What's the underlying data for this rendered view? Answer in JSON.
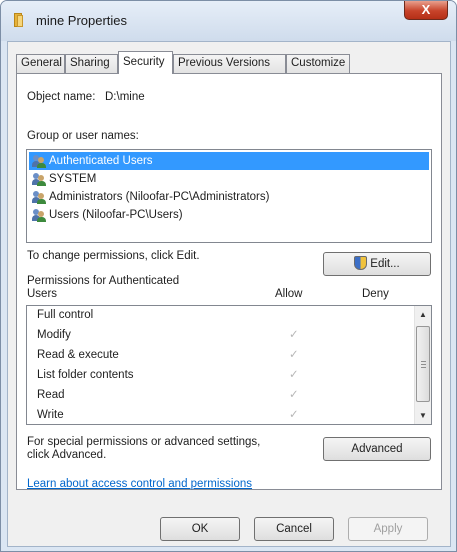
{
  "window": {
    "title": "mine Properties",
    "close_label": "X"
  },
  "tabs": [
    {
      "label": "General"
    },
    {
      "label": "Sharing"
    },
    {
      "label": "Security"
    },
    {
      "label": "Previous Versions"
    },
    {
      "label": "Customize"
    }
  ],
  "object": {
    "label": "Object name:",
    "value": "D:\\mine"
  },
  "groups": {
    "label": "Group or user names:",
    "items": [
      {
        "label": "Authenticated Users",
        "selected": true
      },
      {
        "label": "SYSTEM",
        "selected": false
      },
      {
        "label": "Administrators (Niloofar-PC\\Administrators)",
        "selected": false
      },
      {
        "label": "Users (Niloofar-PC\\Users)",
        "selected": false
      }
    ]
  },
  "change_text": "To change permissions, click Edit.",
  "edit_button": "Edit...",
  "permissions": {
    "header_line1": "Permissions for Authenticated",
    "header_line2": "Users",
    "allow_label": "Allow",
    "deny_label": "Deny",
    "rows": [
      {
        "name": "Full control",
        "allow": false
      },
      {
        "name": "Modify",
        "allow": true
      },
      {
        "name": "Read & execute",
        "allow": true
      },
      {
        "name": "List folder contents",
        "allow": true
      },
      {
        "name": "Read",
        "allow": true
      },
      {
        "name": "Write",
        "allow": true
      }
    ],
    "check_glyph": "✓"
  },
  "special": {
    "line1": "For special permissions or advanced settings,",
    "line2": "click Advanced."
  },
  "advanced_button": "Advanced",
  "link_text": "Learn about access control and permissions",
  "footer": {
    "ok": "OK",
    "cancel": "Cancel",
    "apply": "Apply"
  }
}
